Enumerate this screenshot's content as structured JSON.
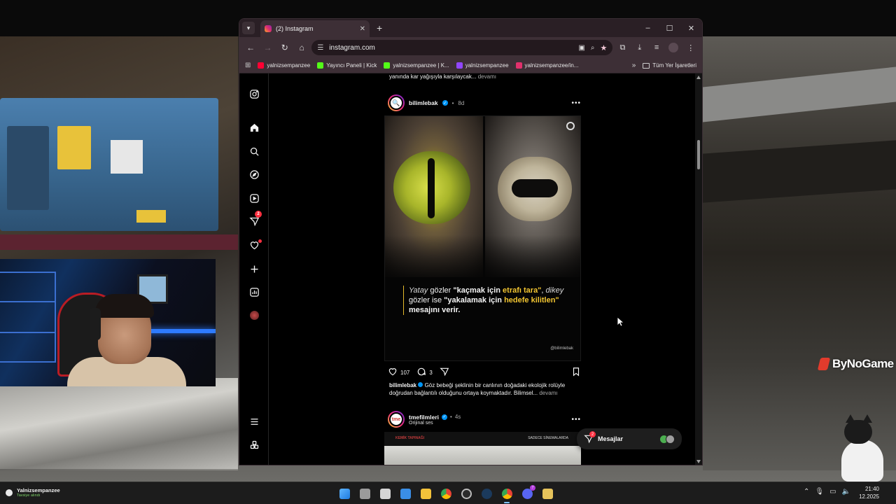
{
  "browser": {
    "tab_title": "(2) Instagram",
    "new_tab": "+",
    "url": "instagram.com",
    "window_controls": [
      "–",
      "☐",
      "✕"
    ],
    "bookmarks": [
      {
        "label": "yalnizsempanzee",
        "color": "#ff0033"
      },
      {
        "label": "Yayıncı Paneli | Kick",
        "color": "#53fc18"
      },
      {
        "label": "yalnizsempanzee | K...",
        "color": "#53fc18"
      },
      {
        "label": "yalnizsempanzee",
        "color": "#9146ff"
      },
      {
        "label": "yalnizsempanzee/in...",
        "color": "#e1306c"
      }
    ],
    "bookmarks_overflow": "»",
    "all_bookmarks": "Tüm Yer İşaretleri"
  },
  "instagram": {
    "sidebar_icons": [
      "instagram-logo-icon",
      "home-icon",
      "search-icon",
      "explore-icon",
      "reels-icon",
      "messages-icon",
      "notifications-icon",
      "create-icon",
      "dashboard-icon",
      "profile-icon",
      "more-icon",
      "also-from-meta-icon"
    ],
    "messages_badge": "2",
    "previous_caption": {
      "text": "yanında kar yağışıyla karşılaycak...",
      "more": "devamı"
    },
    "post": {
      "username": "bilimlebak",
      "time": "8d",
      "image_quote": {
        "part1": "Yatay",
        "part2": " gözler ",
        "part3": "\"kaçmak için ",
        "part4": "etrafı tara\"",
        "part5": ", ",
        "part6": "dikey",
        "part7": " gözler ise ",
        "part8": "\"yakalamak için ",
        "part9": "hedefe kilitlen\"",
        "part10": " mesajını verir."
      },
      "image_credit": "@bilimlebak",
      "likes": "107",
      "comments": "3",
      "caption_user": "bilimlebak",
      "caption_text": " Göz bebeği şeklinin bir canlının doğadaki ekolojik rolüyle doğrudan bağlantılı olduğunu ortaya koymaktadır. Bilimsel...",
      "caption_more": "devamı"
    },
    "next_post": {
      "username": "tmefilmleri",
      "time": "4s",
      "audio": "Orijinal ses",
      "banner_left": "KEMİK TAPINAĞI",
      "banner_mid": "",
      "banner_right": "SADECE SİNEMALARDA"
    },
    "messages_pill": {
      "label": "Mesajlar",
      "badge": "2"
    }
  },
  "overlay": {
    "watermark": "ByNoGame"
  },
  "taskbar": {
    "notification_title": "Yalnizsempanzee",
    "notification_sub": "Tavsiye alındı",
    "time": "21:40",
    "date": "12.2025",
    "apps": [
      {
        "name": "start",
        "color": "#3aa0ff"
      },
      {
        "name": "task-view",
        "color": "#bdbdbd"
      },
      {
        "name": "calendar",
        "color": "#d0d0d0"
      },
      {
        "name": "photos",
        "color": "#3a8ee6"
      },
      {
        "name": "file-explorer",
        "color": "#f3c23a"
      },
      {
        "name": "chrome",
        "color": "#e94235"
      },
      {
        "name": "obs",
        "color": "#6b6b6b"
      },
      {
        "name": "steam",
        "color": "#4a7fb0"
      },
      {
        "name": "chrome-profile",
        "color": "#34a853"
      },
      {
        "name": "discord",
        "color": "#5865f2"
      },
      {
        "name": "media-player",
        "color": "#e6c35b"
      }
    ],
    "discord_badge": "7"
  }
}
